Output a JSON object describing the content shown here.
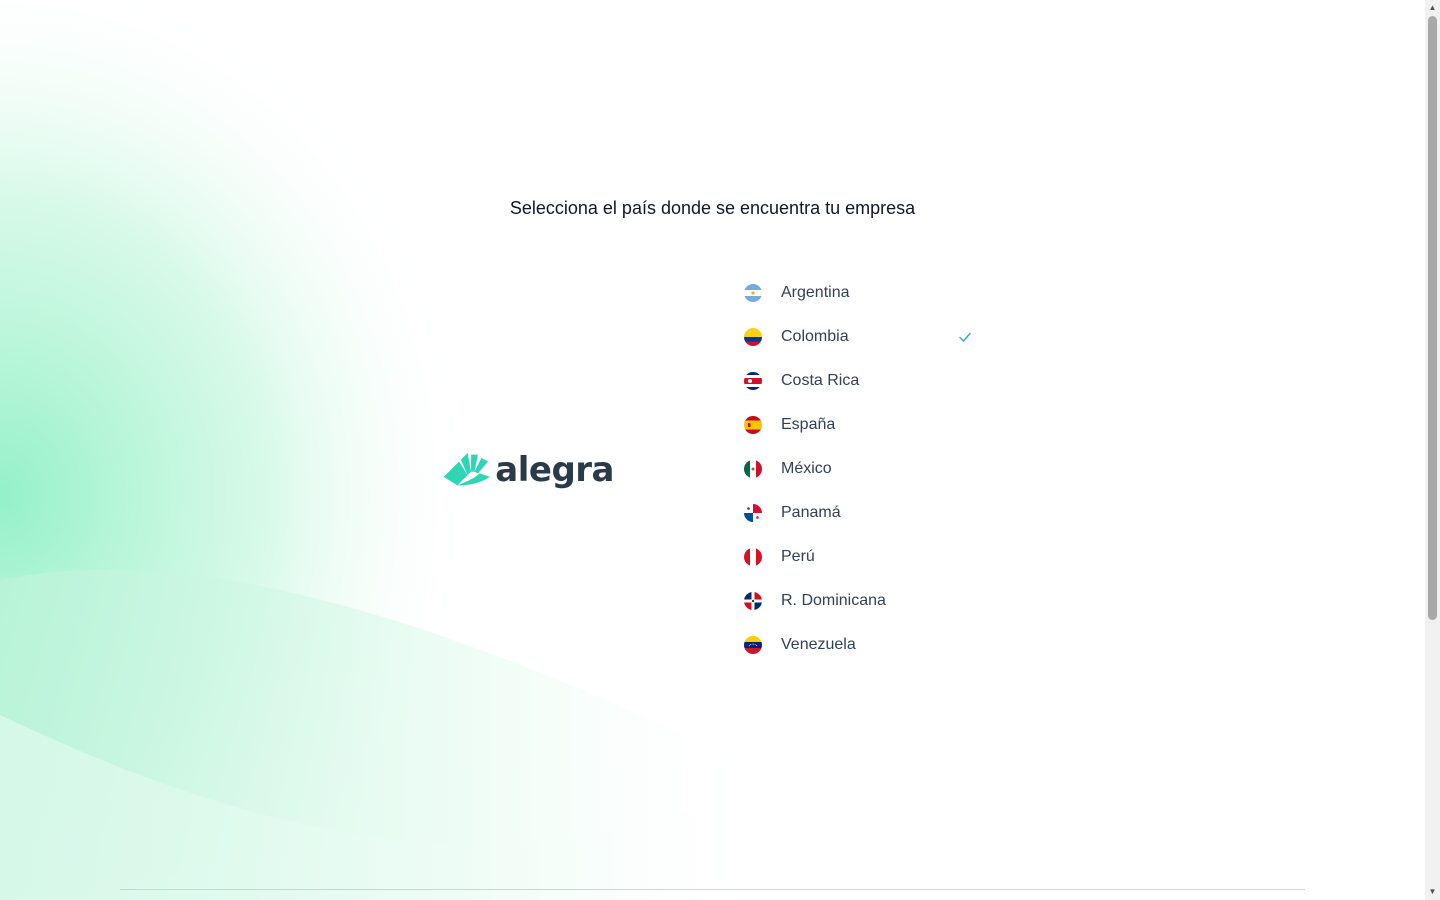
{
  "page": {
    "title": "Selecciona el país donde se encuentra tu empresa"
  },
  "logo": {
    "text": "alegra",
    "accent_color": "#30d5b8",
    "text_color": "#2b3a4b"
  },
  "countries": [
    {
      "name": "Argentina",
      "flag": "argentina-flag-icon",
      "selected": false
    },
    {
      "name": "Colombia",
      "flag": "colombia-flag-icon",
      "selected": true
    },
    {
      "name": "Costa Rica",
      "flag": "costa-rica-flag-icon",
      "selected": false
    },
    {
      "name": "España",
      "flag": "spain-flag-icon",
      "selected": false
    },
    {
      "name": "México",
      "flag": "mexico-flag-icon",
      "selected": false
    },
    {
      "name": "Panamá",
      "flag": "panama-flag-icon",
      "selected": false
    },
    {
      "name": "Perú",
      "flag": "peru-flag-icon",
      "selected": false
    },
    {
      "name": "R. Dominicana",
      "flag": "dominican-republic-flag-icon",
      "selected": false
    },
    {
      "name": "Venezuela",
      "flag": "venezuela-flag-icon",
      "selected": false
    }
  ],
  "colors": {
    "check": "#30a7c9",
    "background_gradient": "#8ef0c4"
  }
}
